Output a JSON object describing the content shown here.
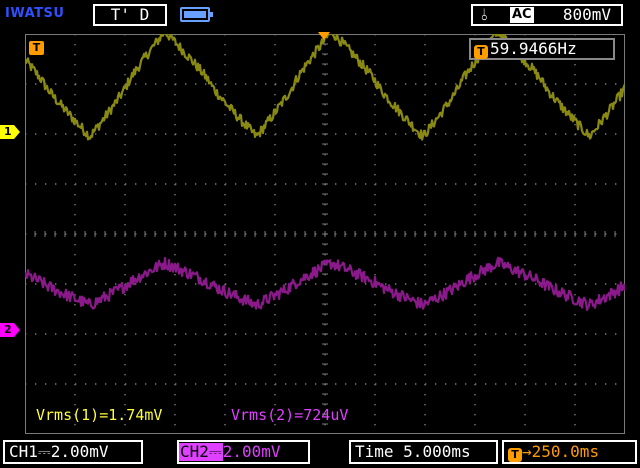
{
  "header": {
    "brand": "IWATSU",
    "run_state": "T' D",
    "trigger_edge_glyph": "⫰",
    "trigger_coupling": "AC",
    "trigger_level": "800mV"
  },
  "screen": {
    "trigger_marker": "T",
    "frequency_badge": "T",
    "frequency": "59.9466Hz",
    "ch1_marker": "1",
    "ch2_marker": "2"
  },
  "measurements": {
    "ch1": "Vrms(1)=1.74mV",
    "ch2": "Vrms(2)=724uV"
  },
  "footer": {
    "ch1_label": "CH1",
    "ch1_coupling_glyph": "⎓",
    "ch1_scale": "2.00mV",
    "ch2_label": "CH2",
    "ch2_coupling_glyph": "⎓",
    "ch2_scale": "2.00mV",
    "time_label": "Time",
    "time_scale": "5.000ms",
    "position_badge": "T",
    "position_arrow": "→",
    "position_value": "250.0ms"
  },
  "colors": {
    "ch1": "#8a8a12",
    "ch2": "#8a1a8a",
    "trigger": "#ff9c00",
    "grid": "#7a7a7a"
  },
  "chart_data": {
    "type": "line",
    "x_divisions": 12,
    "y_divisions": 8,
    "series": [
      {
        "name": "CH1",
        "offset_div": 3.0,
        "amplitude_div": 1.05,
        "period_div": 3.33,
        "phase_div": 1.3,
        "noise_div": 0.1
      },
      {
        "name": "CH2",
        "offset_div": -1.0,
        "amplitude_div": 0.42,
        "period_div": 3.33,
        "phase_div": 1.3,
        "noise_div": 0.12
      }
    ]
  }
}
